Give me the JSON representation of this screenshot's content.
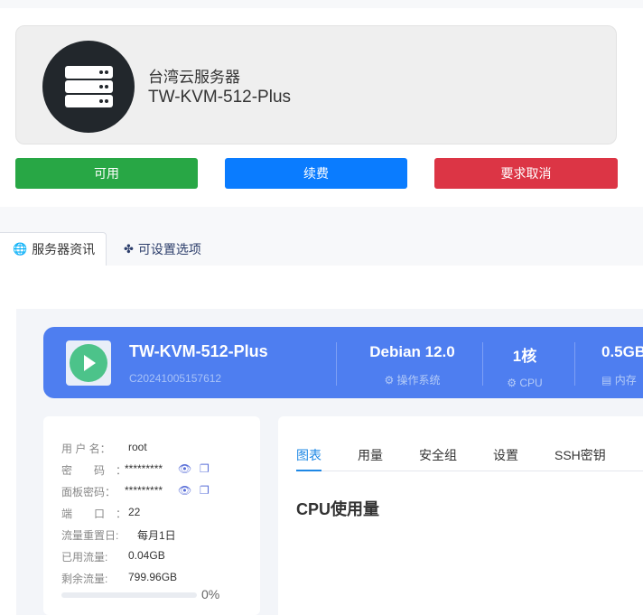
{
  "server": {
    "region": "台湾云服务器",
    "name": "TW-KVM-512-Plus"
  },
  "actions": {
    "status": "可用",
    "renew": "续费",
    "cancel": "要求取消"
  },
  "tabs": {
    "info": "服务器资讯",
    "config": "可设置选项"
  },
  "banner": {
    "name": "TW-KVM-512-Plus",
    "id": "C20241005157612",
    "os_value": "Debian 12.0",
    "os_label": "操作系统",
    "cpu_value": "1核",
    "cpu_label": "CPU",
    "mem_value": "0.5GB",
    "mem_label": "内存"
  },
  "details": {
    "username_label": "用 户 名：",
    "username": "root",
    "password_label": "密　　码　：",
    "password": "*********",
    "panel_pw_label": "面板密码：",
    "panel_pw": "*********",
    "port_label": "端　　口　：",
    "port": "22",
    "reset_label": "流量重置日:",
    "reset": "每月1日",
    "used_label": "已用流量:",
    "used": "0.04GB",
    "remain_label": "剩余流量:",
    "remain": "799.96GB",
    "usage_percent": 0,
    "usage_text": "0%"
  },
  "panel_tabs": {
    "chart": "图表",
    "usage": "用量",
    "security": "安全组",
    "settings": "设置",
    "ssh": "SSH密钥"
  },
  "panel_title": "CPU使用量",
  "colors": {
    "green": "#28a745",
    "blue": "#0a7cff",
    "red": "#dc3545",
    "banner": "#4e7ef0"
  }
}
